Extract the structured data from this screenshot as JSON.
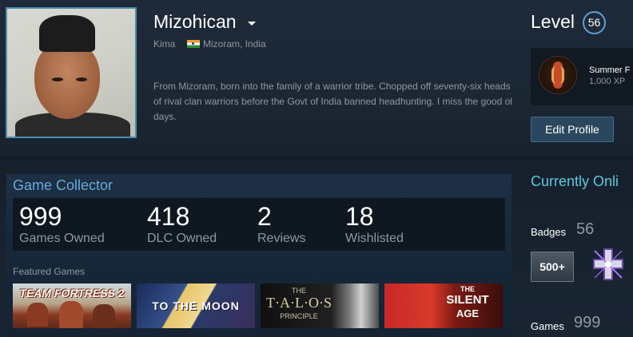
{
  "profile": {
    "persona_name": "Mizohican",
    "real_name": "Kima",
    "location": "Mizoram, India",
    "summary": "From Mizoram, born into the family of a warrior tribe. Chopped off seventy-six heads of rival clan warriors before the Govt of India banned headhunting. I miss the good ol days."
  },
  "level": {
    "label": "Level",
    "value": "56"
  },
  "favorite_badge": {
    "name": "Summer F",
    "xp": "1,000 XP"
  },
  "edit_profile_label": "Edit Profile",
  "showcase": {
    "title": "Game Collector",
    "stats": [
      {
        "value": "999",
        "label": "Games Owned"
      },
      {
        "value": "418",
        "label": "DLC Owned"
      },
      {
        "value": "2",
        "label": "Reviews"
      },
      {
        "value": "18",
        "label": "Wishlisted"
      }
    ],
    "featured_label": "Featured Games",
    "featured_games": [
      {
        "title": "TEAM FORTRESS 2"
      },
      {
        "title": "TO THE MOON"
      },
      {
        "title_line1": "THE",
        "title_line2": "T·A·L·O·S",
        "title_line3": "PRINCIPLE"
      },
      {
        "title_line1": "THE",
        "title_line2": "SILENT",
        "title_line3": "AGE"
      }
    ]
  },
  "sidebar": {
    "status": "Currently Onli",
    "badges_label": "Badges",
    "badges_count": "56",
    "badge_500_label": "500+",
    "games_label": "Games",
    "games_count": "999"
  },
  "colors": {
    "accent_blue": "#66aad9",
    "online_cyan": "#57cbde",
    "level_ring": "#5a9fd8"
  }
}
